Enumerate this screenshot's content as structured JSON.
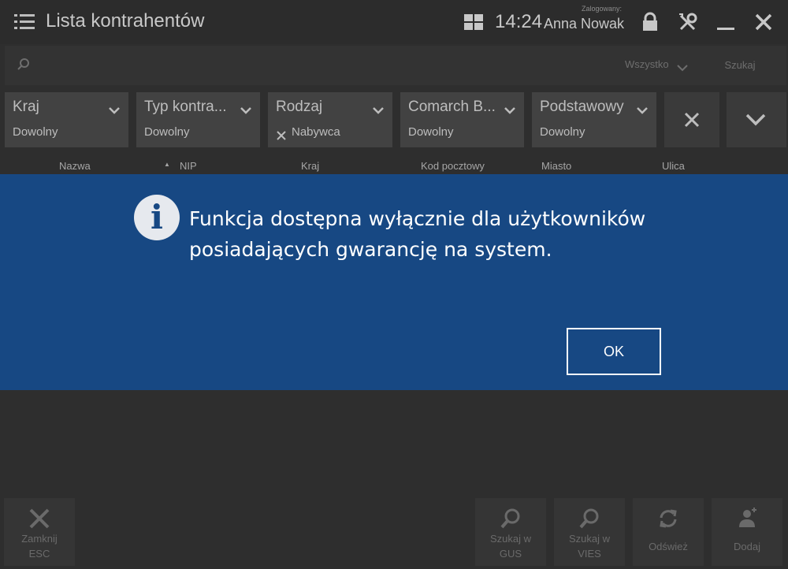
{
  "header": {
    "title": "Lista kontrahentów",
    "clock": "14:24",
    "logged_label": "Zalogowany:",
    "user": "Anna Nowak"
  },
  "search": {
    "value": "",
    "scope": "Wszystko",
    "button": "Szukaj"
  },
  "filters": [
    {
      "label": "Kraj",
      "value": "Dowolny",
      "removable": false
    },
    {
      "label": "Typ kontra...",
      "value": "Dowolny",
      "removable": false
    },
    {
      "label": "Rodzaj",
      "value": "Nabywca",
      "removable": true
    },
    {
      "label": "Comarch B...",
      "value": "Dowolny",
      "removable": false
    },
    {
      "label": "Podstawowy",
      "value": "Dowolny",
      "removable": false
    }
  ],
  "table": {
    "columns": [
      "Nazwa",
      "NIP",
      "Kraj",
      "Kod pocztowy",
      "Miasto",
      "Ulica"
    ],
    "sort_indicator": "▲"
  },
  "dialog": {
    "message": "Funkcja dostępna wyłącznie dla użytkowników posiadających gwarancję na system.",
    "icon": "info-icon",
    "ok": "OK"
  },
  "bottom": {
    "close": "Zamknij\nESC",
    "search_gus": "Szukaj w\nGUS",
    "search_vies": "Szukaj w\nVIES",
    "refresh": "Odśwież",
    "add": "Dodaj"
  },
  "colors": {
    "background": "#2e2e2e",
    "dialog": "#174883",
    "filter_tile": "#424242"
  }
}
